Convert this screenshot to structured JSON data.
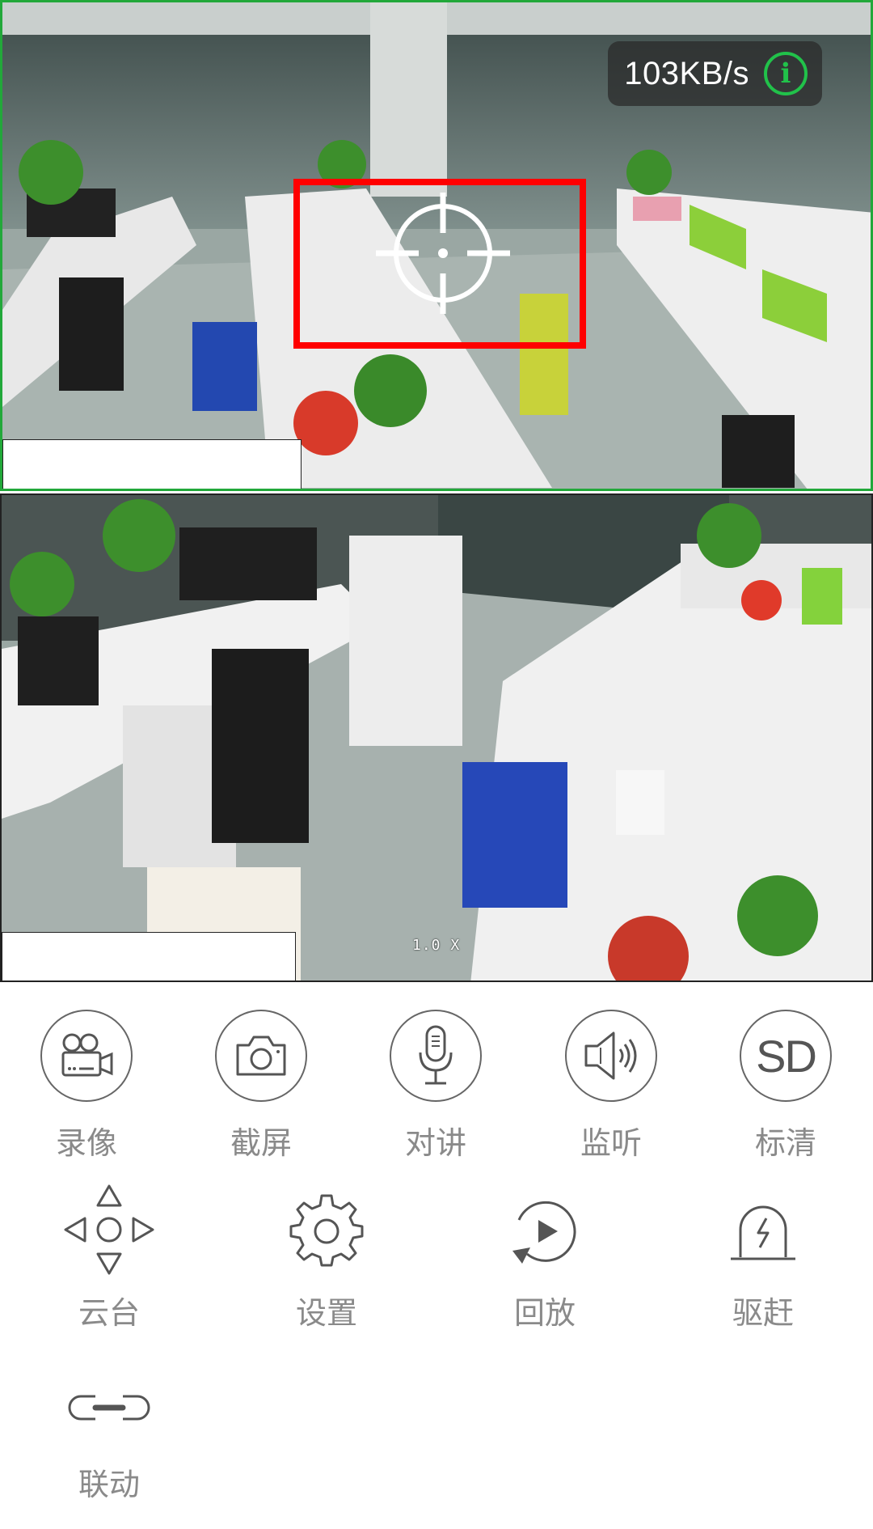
{
  "top_feed": {
    "bitrate": "103KB/s",
    "info_icon": "info-icon",
    "accent": "#22a83a"
  },
  "bottom_feed": {
    "zoom": "1.0 X"
  },
  "controls": {
    "row1": [
      {
        "label": "录像",
        "icon": "video-camera-icon"
      },
      {
        "label": "截屏",
        "icon": "camera-icon"
      },
      {
        "label": "对讲",
        "icon": "microphone-icon"
      },
      {
        "label": "监听",
        "icon": "speaker-icon"
      },
      {
        "label": "标清",
        "icon": "sd-icon",
        "icon_text": "SD"
      }
    ],
    "row2": [
      {
        "label": "云台",
        "icon": "ptz-arrows-icon"
      },
      {
        "label": "设置",
        "icon": "gear-icon"
      },
      {
        "label": "回放",
        "icon": "playback-icon"
      },
      {
        "label": "驱赶",
        "icon": "alarm-icon"
      }
    ],
    "row3": [
      {
        "label": "联动",
        "icon": "link-icon"
      }
    ]
  }
}
